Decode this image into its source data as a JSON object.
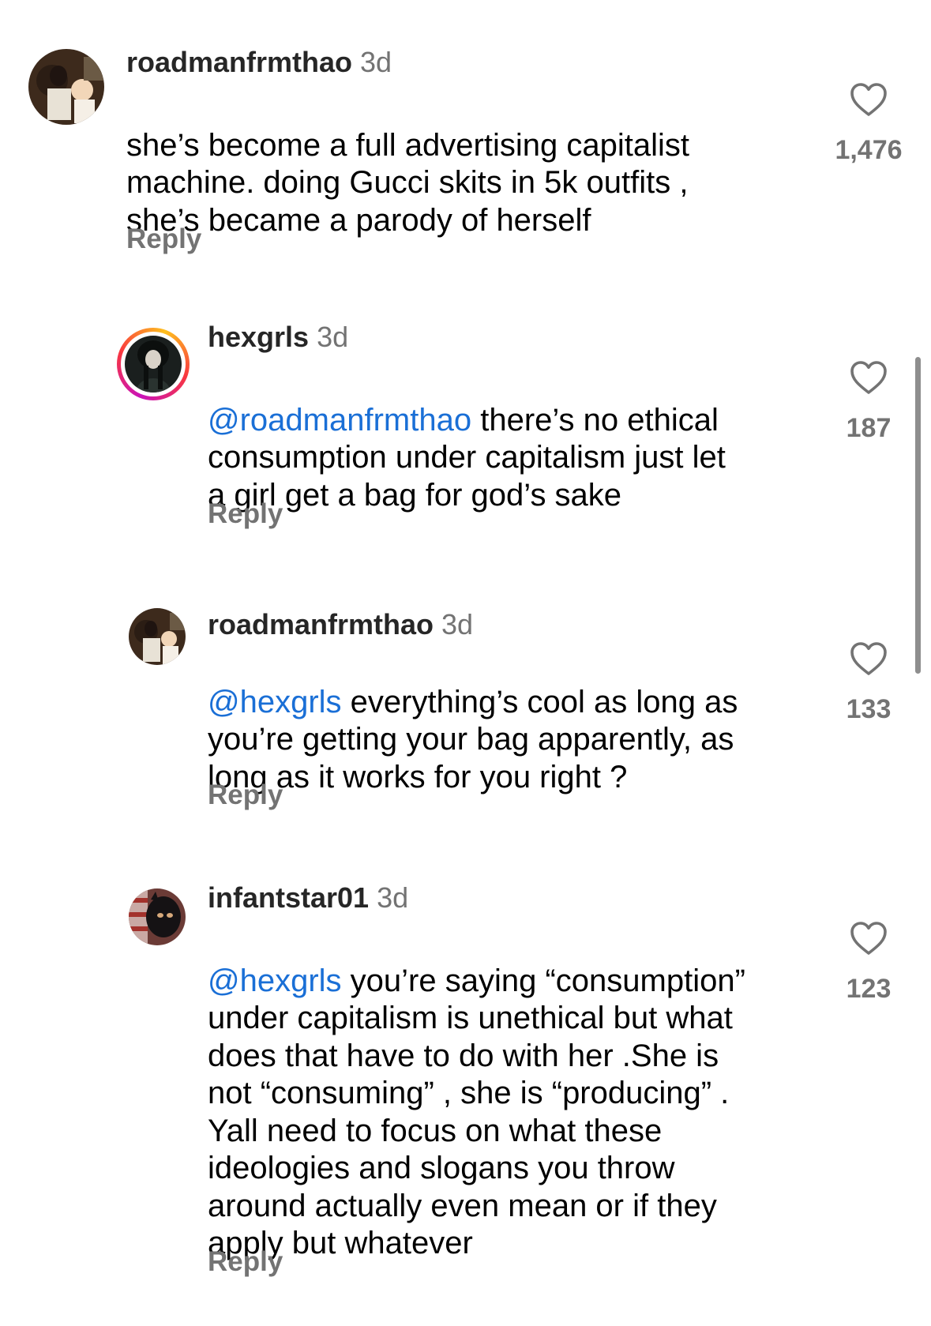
{
  "comments": [
    {
      "username": "roadmanfrmthao",
      "time": "3d",
      "mention": "",
      "text": "she’s become a full advertising capitalist\nmachine. doing Gucci skits in 5k outfits ,\nshe’s became a parody of herself",
      "likes": "1,476",
      "reply_label": "Reply",
      "avatar_icon": "profile-photo"
    },
    {
      "username": "hexgrls",
      "time": "3d",
      "mention": "@roadmanfrmthao",
      "text": " there’s no ethical\nconsumption under capitalism just let\na girl get a bag for god’s sake",
      "likes": "187",
      "reply_label": "Reply",
      "avatar_icon": "profile-photo-story-ring"
    },
    {
      "username": "roadmanfrmthao",
      "time": "3d",
      "mention": "@hexgrls",
      "text": " everything’s cool as long as\nyou’re getting your bag apparently, as\nlong as it works for you right ?",
      "likes": "133",
      "reply_label": "Reply",
      "avatar_icon": "profile-photo"
    },
    {
      "username": "infantstar01",
      "time": "3d",
      "mention": "@hexgrls",
      "text": " you’re saying “consumption”\nunder capitalism is unethical but what\ndoes that have to do with her .She  is\nnot “consuming” , she is “producing” .\nYall need to focus on  what these\nideologies and slogans you throw\naround actually even mean or if they\napply but whatever",
      "likes": "123",
      "reply_label": "Reply",
      "avatar_icon": "profile-photo"
    }
  ],
  "icons": {
    "like": "heart-outline-icon"
  },
  "colors": {
    "mention": "#1a6fd6",
    "secondary_text": "#737373",
    "story_ring": [
      "#c913b9",
      "#f9373f",
      "#fec01e"
    ]
  }
}
